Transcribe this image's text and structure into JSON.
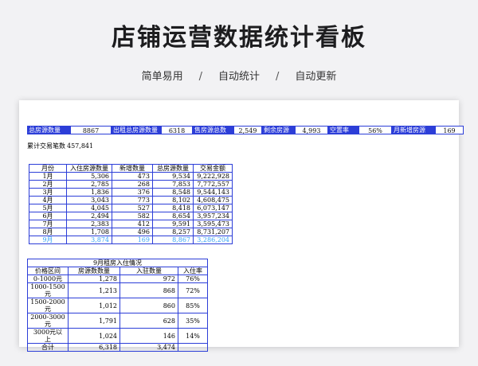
{
  "page": {
    "title": "店铺运营数据统计看板",
    "tags": [
      "简单易用",
      "自动统计",
      "自动更新"
    ],
    "separator": "/"
  },
  "kpis": [
    {
      "label": "总房源数量",
      "value": "8867"
    },
    {
      "label": "出租总房源数量",
      "value": "6318"
    },
    {
      "label": "售房源总数",
      "value": "2,549"
    },
    {
      "label": "剩余房源",
      "value": "4,993"
    },
    {
      "label": "空置率",
      "value": "56%"
    },
    {
      "label": "月新增房源",
      "value": "169"
    }
  ],
  "cumulative": {
    "label": "累计交易笔数",
    "value": "457,841"
  },
  "monthly_table": {
    "headers": [
      "月份",
      "入住房源数量",
      "新增数量",
      "总房源数量",
      "交易金额"
    ],
    "rows": [
      [
        "1月",
        "5,306",
        "473",
        "9,534",
        "9,222,928"
      ],
      [
        "2月",
        "2,785",
        "268",
        "7,853",
        "7,772,557"
      ],
      [
        "3月",
        "1,836",
        "376",
        "8,548",
        "9,544,143"
      ],
      [
        "4月",
        "3,043",
        "773",
        "8,102",
        "4,608,475"
      ],
      [
        "5月",
        "4,045",
        "527",
        "8,418",
        "6,073,147"
      ],
      [
        "6月",
        "2,494",
        "582",
        "8,654",
        "3,957,234"
      ],
      [
        "7月",
        "2,383",
        "412",
        "9,591",
        "3,595,473"
      ],
      [
        "8月",
        "1,708",
        "496",
        "8,257",
        "8,731,207"
      ],
      [
        "9月",
        "3,874",
        "169",
        "8,867",
        "3,286,204"
      ]
    ]
  },
  "sept_table": {
    "title": "9月租房入住情况",
    "headers": [
      "价格区间",
      "房源数数量",
      "入驻数量",
      "入住率"
    ],
    "rows": [
      [
        "0-1000元",
        "1,278",
        "972",
        "76%"
      ],
      [
        "1000-1500元",
        "1,213",
        "868",
        "72%"
      ],
      [
        "1500-2000元",
        "1,012",
        "860",
        "85%"
      ],
      [
        "2000-3000元",
        "1,791",
        "628",
        "35%"
      ],
      [
        "3000元以上",
        "1,024",
        "146",
        "14%"
      ],
      [
        "合计",
        "6,318",
        "3,474",
        ""
      ]
    ]
  },
  "colors": {
    "accent": "#2c3ed8",
    "highlight": "#35a3f5"
  }
}
